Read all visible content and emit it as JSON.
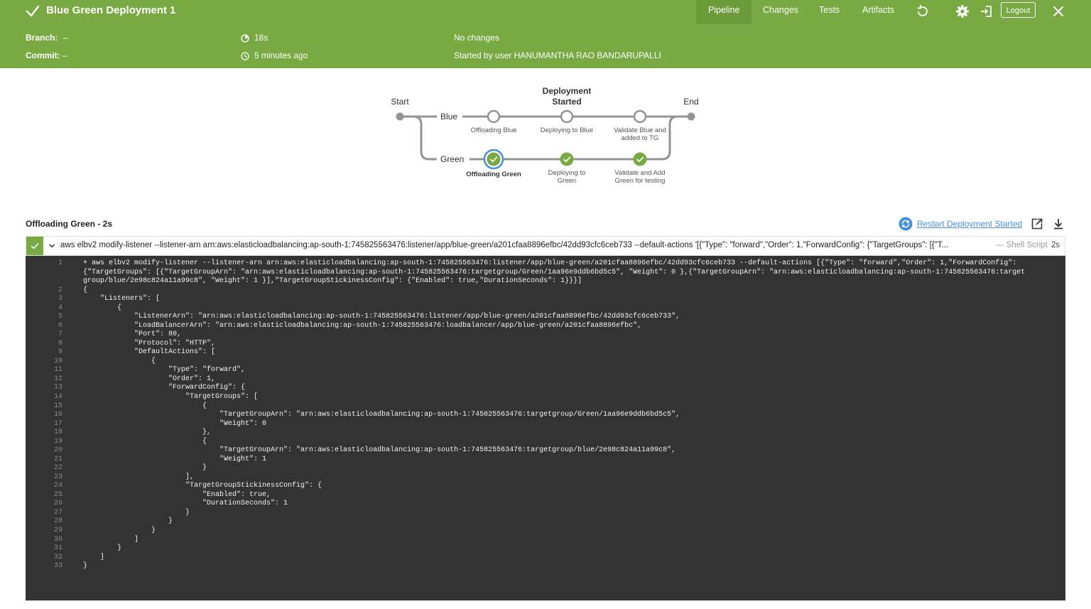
{
  "header": {
    "title": "Blue Green Deployment",
    "run_number": "1",
    "tabs": [
      "Pipeline",
      "Changes",
      "Tests",
      "Artifacts"
    ],
    "active_tab": "Pipeline",
    "logout_label": "Logout",
    "bg_color": "#78a942"
  },
  "summary": {
    "branch_label": "Branch:",
    "branch_value": "–",
    "commit_label": "Commit:",
    "commit_value": "–",
    "duration": "18s",
    "time_ago": "5 minutes ago",
    "changes": "No changes",
    "started_by": "Started by user HANUMANTHA RAO BANDARUPALLI"
  },
  "pipeline": {
    "start_label": "Start",
    "end_label": "End",
    "parallel_stage_line1": "Deployment",
    "parallel_stage_line2": "Started",
    "branches": [
      {
        "name": "Blue",
        "steps": [
          {
            "line1": "Offloading Blue",
            "line2": "",
            "status": "not-run"
          },
          {
            "line1": "Deploying to Blue",
            "line2": "",
            "status": "not-run"
          },
          {
            "line1": "Validate Blue and",
            "line2": "added to TG",
            "status": "not-run"
          }
        ]
      },
      {
        "name": "Green",
        "steps": [
          {
            "line1": "Offloading Green",
            "line2": "",
            "status": "success-selected"
          },
          {
            "line1": "Deploying to",
            "line2": "Green",
            "status": "success"
          },
          {
            "line1": "Validate and Add",
            "line2": "Green for testing",
            "status": "success"
          }
        ]
      }
    ]
  },
  "step": {
    "title": "Offloading Green - 2s",
    "restart_label": "Restart Deployment Started",
    "command": "aws elbv2 modify-listener --listener-arn arn:aws:elasticloadbalancing:ap-south-1:745825563476:listener/app/blue-green/a201cfaa8896efbc/42dd93cfc6ceb733 --default-actions '[{\"Type\": \"forward\",\"Order\": 1,\"ForwardConfig\": {\"TargetGroups\": [{\"T...",
    "type": "— Shell Script",
    "duration": "2s"
  },
  "log": [
    {
      "n": "1",
      "text": "+ aws elbv2 modify-listener --listener-arn arn:aws:elasticloadbalancing:ap-south-1:745825563476:listener/app/blue-green/a201cfaa8896efbc/42dd93cfc6ceb733 --default-actions [{\"Type\": \"forward\",\"Order\": 1,\"ForwardConfig\": {\"TargetGroups\": [{\"TargetGroupArn\": \"arn:aws:elasticloadbalancing:ap-south-1:745825563476:targetgroup/Green/1aa96e9ddb6bd5c5\", \"Weight\": 0 },{\"TargetGroupArn\": \"arn:aws:elasticloadbalancing:ap-south-1:745825563476:targetgroup/blue/2e98c824a11a99c8\", \"Weight\": 1 }],\"TargetGroupStickinessConfig\": {\"Enabled\": true,\"DurationSeconds\": 1}}}]"
    },
    {
      "n": "2",
      "text": "{"
    },
    {
      "n": "3",
      "text": "    \"Listeners\": ["
    },
    {
      "n": "4",
      "text": "        {"
    },
    {
      "n": "5",
      "text": "            \"ListenerArn\": \"arn:aws:elasticloadbalancing:ap-south-1:745825563476:listener/app/blue-green/a201cfaa8896efbc/42dd93cfc6ceb733\","
    },
    {
      "n": "6",
      "text": "            \"LoadBalancerArn\": \"arn:aws:elasticloadbalancing:ap-south-1:745825563476:loadbalancer/app/blue-green/a201cfaa8896efbc\","
    },
    {
      "n": "7",
      "text": "            \"Port\": 80,"
    },
    {
      "n": "8",
      "text": "            \"Protocol\": \"HTTP\","
    },
    {
      "n": "9",
      "text": "            \"DefaultActions\": ["
    },
    {
      "n": "10",
      "text": "                {"
    },
    {
      "n": "11",
      "text": "                    \"Type\": \"forward\","
    },
    {
      "n": "12",
      "text": "                    \"Order\": 1,"
    },
    {
      "n": "13",
      "text": "                    \"ForwardConfig\": {"
    },
    {
      "n": "14",
      "text": "                        \"TargetGroups\": ["
    },
    {
      "n": "15",
      "text": "                            {"
    },
    {
      "n": "16",
      "text": "                                \"TargetGroupArn\": \"arn:aws:elasticloadbalancing:ap-south-1:745825563476:targetgroup/Green/1aa96e9ddb6bd5c5\","
    },
    {
      "n": "17",
      "text": "                                \"Weight\": 0"
    },
    {
      "n": "18",
      "text": "                            },"
    },
    {
      "n": "19",
      "text": "                            {"
    },
    {
      "n": "20",
      "text": "                                \"TargetGroupArn\": \"arn:aws:elasticloadbalancing:ap-south-1:745825563476:targetgroup/blue/2e98c824a11a99c8\","
    },
    {
      "n": "21",
      "text": "                                \"Weight\": 1"
    },
    {
      "n": "22",
      "text": "                            }"
    },
    {
      "n": "23",
      "text": "                        ],"
    },
    {
      "n": "24",
      "text": "                        \"TargetGroupStickinessConfig\": {"
    },
    {
      "n": "25",
      "text": "                            \"Enabled\": true,"
    },
    {
      "n": "26",
      "text": "                            \"DurationSeconds\": 1"
    },
    {
      "n": "27",
      "text": "                        }"
    },
    {
      "n": "28",
      "text": "                    }"
    },
    {
      "n": "29",
      "text": "                }"
    },
    {
      "n": "30",
      "text": "            ]"
    },
    {
      "n": "31",
      "text": "        }"
    },
    {
      "n": "32",
      "text": "    ]"
    },
    {
      "n": "33",
      "text": "}"
    }
  ]
}
